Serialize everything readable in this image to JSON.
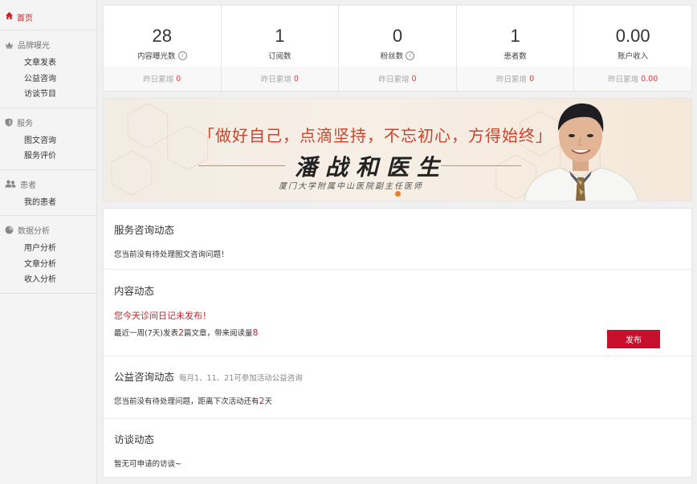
{
  "sidebar": {
    "home_label": "首页",
    "groups": [
      {
        "title": "品牌曝光",
        "icon": "crown-icon",
        "items": [
          "文章发表",
          "公益咨询",
          "访谈节目"
        ]
      },
      {
        "title": "服务",
        "icon": "shield-icon",
        "items": [
          "图文咨询",
          "服务评价"
        ]
      },
      {
        "title": "患者",
        "icon": "users-icon",
        "items": [
          "我的患者"
        ]
      },
      {
        "title": "数据分析",
        "icon": "pie-chart-icon",
        "items": [
          "用户分析",
          "文章分析",
          "收入分析"
        ]
      }
    ]
  },
  "stats": [
    {
      "value": "28",
      "label": "内容曝光数",
      "info": true,
      "yesterday_label": "昨日累增",
      "yesterday_value": "0"
    },
    {
      "value": "1",
      "label": "订阅数",
      "info": false,
      "yesterday_label": "昨日累增",
      "yesterday_value": "0"
    },
    {
      "value": "0",
      "label": "粉丝数",
      "info": true,
      "yesterday_label": "昨日累增",
      "yesterday_value": "0"
    },
    {
      "value": "1",
      "label": "患者数",
      "info": false,
      "yesterday_label": "昨日累增",
      "yesterday_value": "0"
    },
    {
      "value": "0.00",
      "label": "账户收入",
      "info": false,
      "yesterday_label": "昨日累增",
      "yesterday_value": "0.00"
    }
  ],
  "banner": {
    "slogan": "「做好自己，点滴坚持，不忘初心，方得始终」",
    "name": "潘战和医生",
    "subtitle": "厦门大学附属中山医院副主任医师"
  },
  "service": {
    "title": "服务咨询动态",
    "text": "您当前没有待处理图文咨询问题！"
  },
  "content": {
    "title": "内容动态",
    "alert": "您今天诊间日记未发布！",
    "stat_prefix": "最近一周(7天)发表",
    "articles": "2",
    "stat_mid": "篇文章，带来阅读量",
    "reads": "8",
    "publish_label": "发布"
  },
  "charity": {
    "title": "公益咨询动态",
    "subtitle": "每月1、11、21可参加活动公益咨询",
    "text_prefix": "您当前没有待处理问题，距离下次活动还有",
    "days": "2",
    "text_suffix": "天"
  },
  "interview": {
    "title": "访谈动态",
    "text": "暂无可申请的访谈~"
  },
  "colors": {
    "accent": "#c1272d",
    "button": "#c8102e",
    "stat_number": "#e0393e"
  }
}
